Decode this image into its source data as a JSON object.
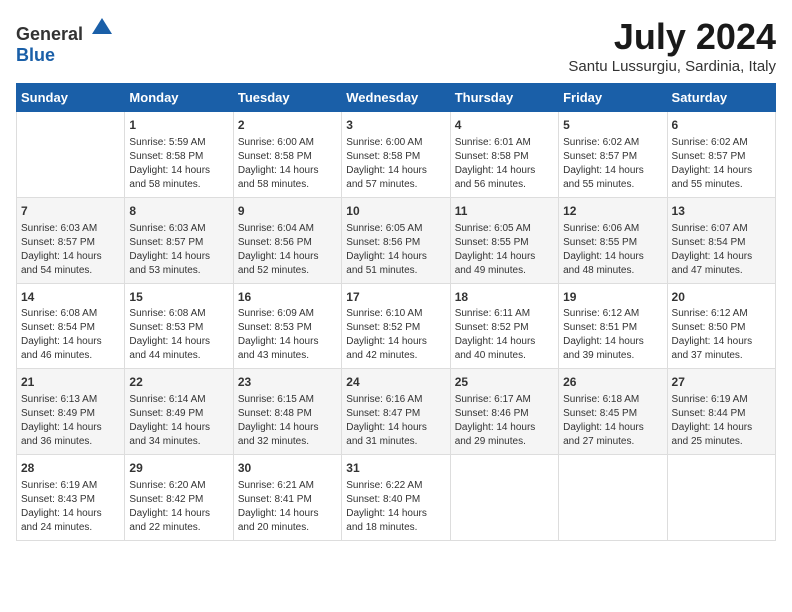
{
  "logo": {
    "general": "General",
    "blue": "Blue"
  },
  "title": "July 2024",
  "subtitle": "Santu Lussurgiu, Sardinia, Italy",
  "days_of_week": [
    "Sunday",
    "Monday",
    "Tuesday",
    "Wednesday",
    "Thursday",
    "Friday",
    "Saturday"
  ],
  "weeks": [
    [
      {
        "day": "",
        "sunrise": "",
        "sunset": "",
        "daylight": ""
      },
      {
        "day": "1",
        "sunrise": "Sunrise: 5:59 AM",
        "sunset": "Sunset: 8:58 PM",
        "daylight": "Daylight: 14 hours and 58 minutes."
      },
      {
        "day": "2",
        "sunrise": "Sunrise: 6:00 AM",
        "sunset": "Sunset: 8:58 PM",
        "daylight": "Daylight: 14 hours and 58 minutes."
      },
      {
        "day": "3",
        "sunrise": "Sunrise: 6:00 AM",
        "sunset": "Sunset: 8:58 PM",
        "daylight": "Daylight: 14 hours and 57 minutes."
      },
      {
        "day": "4",
        "sunrise": "Sunrise: 6:01 AM",
        "sunset": "Sunset: 8:58 PM",
        "daylight": "Daylight: 14 hours and 56 minutes."
      },
      {
        "day": "5",
        "sunrise": "Sunrise: 6:02 AM",
        "sunset": "Sunset: 8:57 PM",
        "daylight": "Daylight: 14 hours and 55 minutes."
      },
      {
        "day": "6",
        "sunrise": "Sunrise: 6:02 AM",
        "sunset": "Sunset: 8:57 PM",
        "daylight": "Daylight: 14 hours and 55 minutes."
      }
    ],
    [
      {
        "day": "7",
        "sunrise": "Sunrise: 6:03 AM",
        "sunset": "Sunset: 8:57 PM",
        "daylight": "Daylight: 14 hours and 54 minutes."
      },
      {
        "day": "8",
        "sunrise": "Sunrise: 6:03 AM",
        "sunset": "Sunset: 8:57 PM",
        "daylight": "Daylight: 14 hours and 53 minutes."
      },
      {
        "day": "9",
        "sunrise": "Sunrise: 6:04 AM",
        "sunset": "Sunset: 8:56 PM",
        "daylight": "Daylight: 14 hours and 52 minutes."
      },
      {
        "day": "10",
        "sunrise": "Sunrise: 6:05 AM",
        "sunset": "Sunset: 8:56 PM",
        "daylight": "Daylight: 14 hours and 51 minutes."
      },
      {
        "day": "11",
        "sunrise": "Sunrise: 6:05 AM",
        "sunset": "Sunset: 8:55 PM",
        "daylight": "Daylight: 14 hours and 49 minutes."
      },
      {
        "day": "12",
        "sunrise": "Sunrise: 6:06 AM",
        "sunset": "Sunset: 8:55 PM",
        "daylight": "Daylight: 14 hours and 48 minutes."
      },
      {
        "day": "13",
        "sunrise": "Sunrise: 6:07 AM",
        "sunset": "Sunset: 8:54 PM",
        "daylight": "Daylight: 14 hours and 47 minutes."
      }
    ],
    [
      {
        "day": "14",
        "sunrise": "Sunrise: 6:08 AM",
        "sunset": "Sunset: 8:54 PM",
        "daylight": "Daylight: 14 hours and 46 minutes."
      },
      {
        "day": "15",
        "sunrise": "Sunrise: 6:08 AM",
        "sunset": "Sunset: 8:53 PM",
        "daylight": "Daylight: 14 hours and 44 minutes."
      },
      {
        "day": "16",
        "sunrise": "Sunrise: 6:09 AM",
        "sunset": "Sunset: 8:53 PM",
        "daylight": "Daylight: 14 hours and 43 minutes."
      },
      {
        "day": "17",
        "sunrise": "Sunrise: 6:10 AM",
        "sunset": "Sunset: 8:52 PM",
        "daylight": "Daylight: 14 hours and 42 minutes."
      },
      {
        "day": "18",
        "sunrise": "Sunrise: 6:11 AM",
        "sunset": "Sunset: 8:52 PM",
        "daylight": "Daylight: 14 hours and 40 minutes."
      },
      {
        "day": "19",
        "sunrise": "Sunrise: 6:12 AM",
        "sunset": "Sunset: 8:51 PM",
        "daylight": "Daylight: 14 hours and 39 minutes."
      },
      {
        "day": "20",
        "sunrise": "Sunrise: 6:12 AM",
        "sunset": "Sunset: 8:50 PM",
        "daylight": "Daylight: 14 hours and 37 minutes."
      }
    ],
    [
      {
        "day": "21",
        "sunrise": "Sunrise: 6:13 AM",
        "sunset": "Sunset: 8:49 PM",
        "daylight": "Daylight: 14 hours and 36 minutes."
      },
      {
        "day": "22",
        "sunrise": "Sunrise: 6:14 AM",
        "sunset": "Sunset: 8:49 PM",
        "daylight": "Daylight: 14 hours and 34 minutes."
      },
      {
        "day": "23",
        "sunrise": "Sunrise: 6:15 AM",
        "sunset": "Sunset: 8:48 PM",
        "daylight": "Daylight: 14 hours and 32 minutes."
      },
      {
        "day": "24",
        "sunrise": "Sunrise: 6:16 AM",
        "sunset": "Sunset: 8:47 PM",
        "daylight": "Daylight: 14 hours and 31 minutes."
      },
      {
        "day": "25",
        "sunrise": "Sunrise: 6:17 AM",
        "sunset": "Sunset: 8:46 PM",
        "daylight": "Daylight: 14 hours and 29 minutes."
      },
      {
        "day": "26",
        "sunrise": "Sunrise: 6:18 AM",
        "sunset": "Sunset: 8:45 PM",
        "daylight": "Daylight: 14 hours and 27 minutes."
      },
      {
        "day": "27",
        "sunrise": "Sunrise: 6:19 AM",
        "sunset": "Sunset: 8:44 PM",
        "daylight": "Daylight: 14 hours and 25 minutes."
      }
    ],
    [
      {
        "day": "28",
        "sunrise": "Sunrise: 6:19 AM",
        "sunset": "Sunset: 8:43 PM",
        "daylight": "Daylight: 14 hours and 24 minutes."
      },
      {
        "day": "29",
        "sunrise": "Sunrise: 6:20 AM",
        "sunset": "Sunset: 8:42 PM",
        "daylight": "Daylight: 14 hours and 22 minutes."
      },
      {
        "day": "30",
        "sunrise": "Sunrise: 6:21 AM",
        "sunset": "Sunset: 8:41 PM",
        "daylight": "Daylight: 14 hours and 20 minutes."
      },
      {
        "day": "31",
        "sunrise": "Sunrise: 6:22 AM",
        "sunset": "Sunset: 8:40 PM",
        "daylight": "Daylight: 14 hours and 18 minutes."
      },
      {
        "day": "",
        "sunrise": "",
        "sunset": "",
        "daylight": ""
      },
      {
        "day": "",
        "sunrise": "",
        "sunset": "",
        "daylight": ""
      },
      {
        "day": "",
        "sunrise": "",
        "sunset": "",
        "daylight": ""
      }
    ]
  ]
}
